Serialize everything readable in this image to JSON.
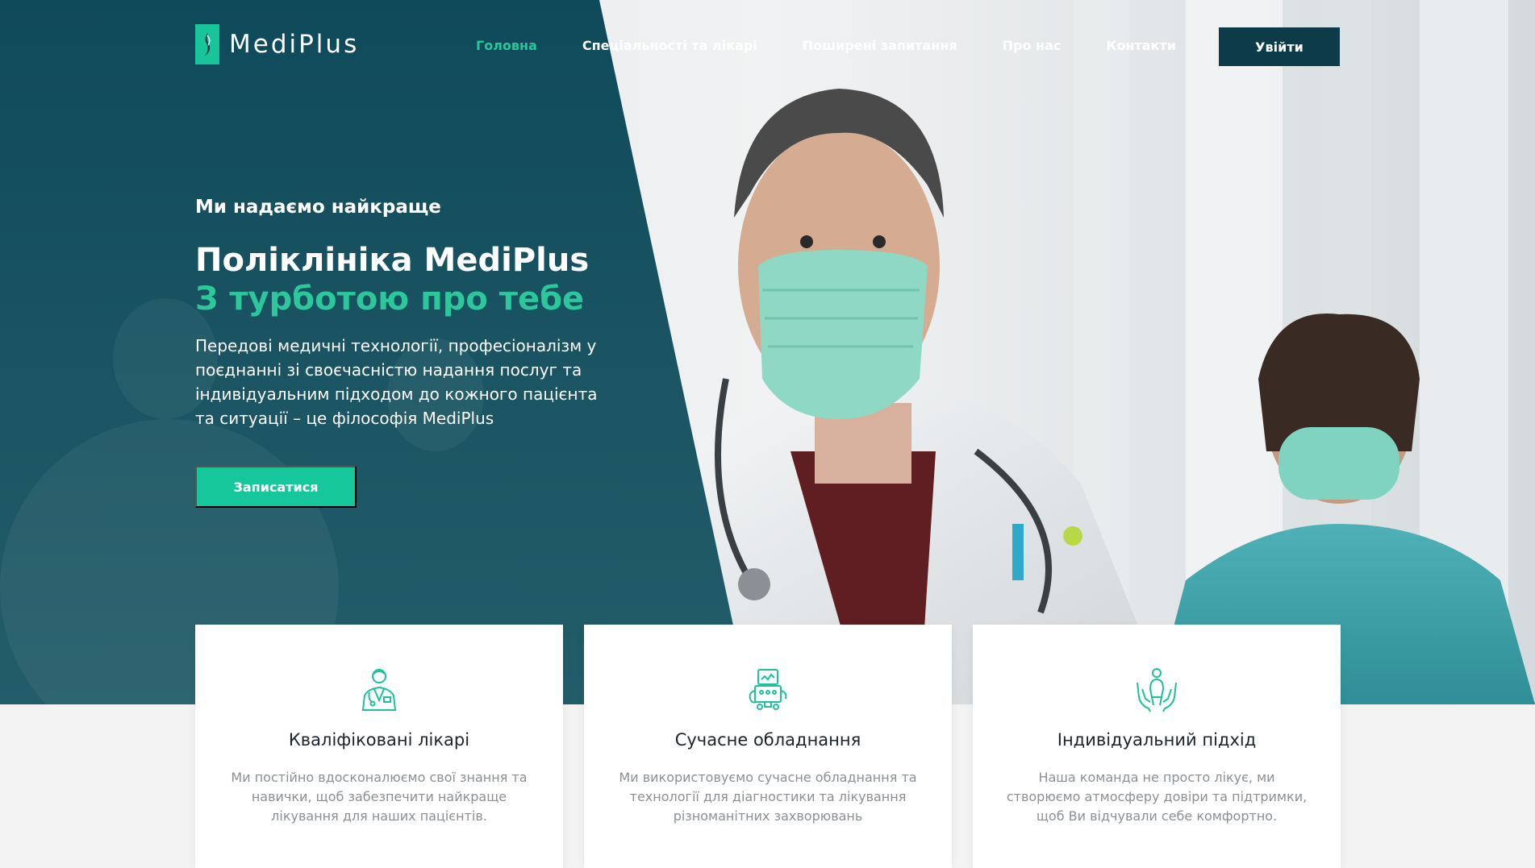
{
  "brand": {
    "name": "MediPlus",
    "accent": "#18c59b",
    "dark": "#0e3b4a"
  },
  "nav": {
    "items": [
      {
        "label": "Головна",
        "active": true
      },
      {
        "label": "Спеціальності та лікарі",
        "active": false
      },
      {
        "label": "Поширені запитання",
        "active": false
      },
      {
        "label": "Про нас",
        "active": false
      },
      {
        "label": "Контакти",
        "active": false
      }
    ],
    "login_label": "Увійти"
  },
  "hero": {
    "eyebrow": "Ми надаємо найкраще",
    "title": "Поліклініка MediPlus",
    "subtitle": "З турботою про тебе",
    "lead": "Передові медичні технології, професіоналізм у поєднанні зі своєчасністю надання послуг та індивідуальним підходом до кожного пацієнта та ситуації – це філософія MediPlus",
    "cta_label": "Записатися"
  },
  "features": [
    {
      "icon": "doctor-icon",
      "title": "Кваліфіковані лікарі",
      "text": "Ми постійно вдосконалюємо свої знання та навички, щоб забезпечити найкраще лікування для наших пацієнтів."
    },
    {
      "icon": "medical-equipment-icon",
      "title": "Сучасне обладнання",
      "text": "Ми використовуємо сучасне обладнання та технології для діагностики та лікування різноманітних захворювань"
    },
    {
      "icon": "care-hands-icon",
      "title": "Індивідуальний підхід",
      "text": "Наша команда не просто лікує, ми створюємо атмосферу довіри та підтримки, щоб Ви відчували себе комфортно."
    }
  ]
}
